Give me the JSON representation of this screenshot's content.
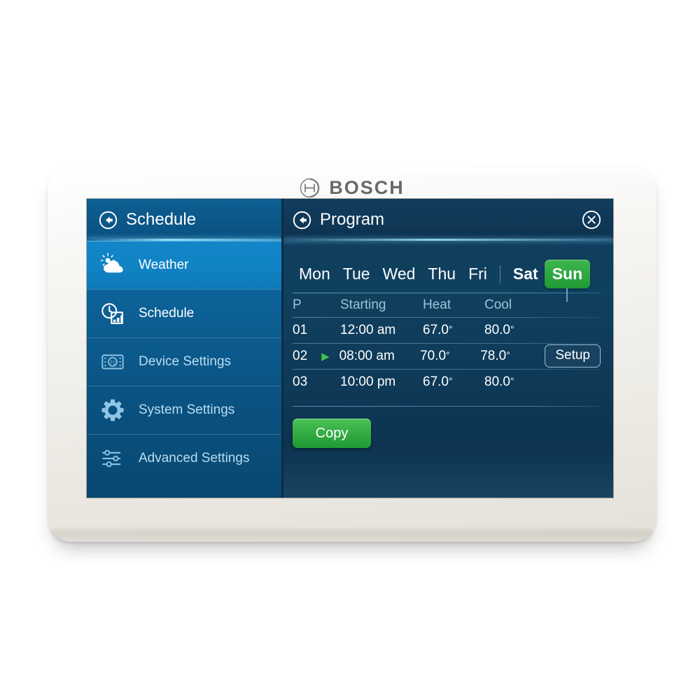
{
  "brand": {
    "name": "BOSCH",
    "logo_icon": "bosch-logo-icon"
  },
  "left_panel": {
    "header": {
      "title": "Schedule",
      "back_icon": "back-arrow-icon"
    },
    "items": [
      {
        "label": "Weather",
        "icon": "weather-cloud-sun-icon",
        "state": "selected"
      },
      {
        "label": "Schedule",
        "icon": "clock-calendar-icon",
        "state": "active"
      },
      {
        "label": "Device Settings",
        "icon": "thermostat-device-icon",
        "state": "normal"
      },
      {
        "label": "System Settings",
        "icon": "gear-icon",
        "state": "normal"
      },
      {
        "label": "Advanced Settings",
        "icon": "sliders-icon",
        "state": "normal"
      }
    ]
  },
  "right_panel": {
    "header": {
      "title": "Program",
      "back_icon": "back-arrow-icon",
      "close_icon": "close-circle-icon"
    },
    "days": [
      {
        "label": "Mon",
        "selected": false,
        "bold": false
      },
      {
        "label": "Tue",
        "selected": false,
        "bold": false
      },
      {
        "label": "Wed",
        "selected": false,
        "bold": false
      },
      {
        "label": "Thu",
        "selected": false,
        "bold": false
      },
      {
        "label": "Fri",
        "selected": false,
        "bold": false
      },
      {
        "label": "Sat",
        "selected": false,
        "bold": true
      },
      {
        "label": "Sun",
        "selected": true,
        "bold": true
      }
    ],
    "table": {
      "columns": {
        "p": "P",
        "starting": "Starting",
        "heat": "Heat",
        "cool": "Cool"
      },
      "rows": [
        {
          "p": "01",
          "active": false,
          "starting": "12:00 am",
          "heat": "67.0",
          "cool": "80.0",
          "degree": "°",
          "action": null
        },
        {
          "p": "02",
          "active": true,
          "starting": "08:00 am",
          "heat": "70.0",
          "cool": "78.0",
          "degree": "°",
          "action": "Setup"
        },
        {
          "p": "03",
          "active": false,
          "starting": "10:00 pm",
          "heat": "67.0",
          "cool": "80.0",
          "degree": "°",
          "action": null
        }
      ]
    },
    "copy_button": "Copy"
  },
  "colors": {
    "accent_green": "#31a843",
    "panel_blue": "#0c5e92",
    "screen_navy": "#0f3b5c",
    "brand_gray": "#6a6a6a"
  }
}
